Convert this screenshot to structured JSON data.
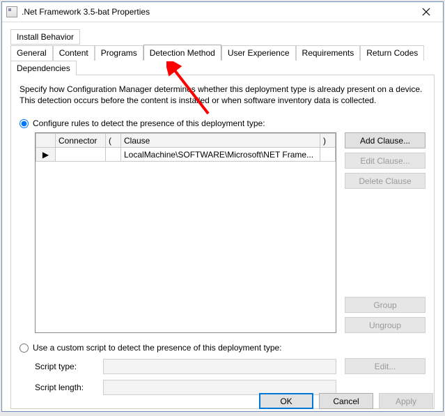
{
  "window": {
    "title": ".Net Framework 3.5-bat Properties",
    "close_icon": "close-icon"
  },
  "tabs": {
    "row1": [
      "Install Behavior"
    ],
    "row2": [
      "General",
      "Content",
      "Programs",
      "Detection Method",
      "User Experience",
      "Requirements",
      "Return Codes",
      "Dependencies"
    ],
    "active": "Detection Method"
  },
  "page": {
    "description": "Specify how Configuration Manager determines whether this deployment type is already present on a device. This detection occurs before the content is installed or when software inventory data is collected.",
    "radio_rules": "Configure rules to detect the presence of this deployment type:",
    "radio_script": "Use a custom script to detect the presence of this deployment type:"
  },
  "grid": {
    "headers": {
      "rowhdr": "",
      "connector": "Connector",
      "lparen": "(",
      "clause": "Clause",
      "rparen": ")"
    },
    "rows": [
      {
        "marker": "▶",
        "connector": "",
        "lparen": "",
        "clause": "LocalMachine\\SOFTWARE\\Microsoft\\NET Frame...",
        "rparen": ""
      }
    ]
  },
  "buttons": {
    "add_clause": "Add Clause...",
    "edit_clause": "Edit Clause...",
    "delete_clause": "Delete Clause",
    "group": "Group",
    "ungroup": "Ungroup",
    "edit_script": "Edit..."
  },
  "script": {
    "type_label": "Script type:",
    "type_value": "",
    "length_label": "Script length:",
    "length_value": ""
  },
  "dialog_buttons": {
    "ok": "OK",
    "cancel": "Cancel",
    "apply": "Apply"
  },
  "annotation": {
    "has_arrow": true
  }
}
